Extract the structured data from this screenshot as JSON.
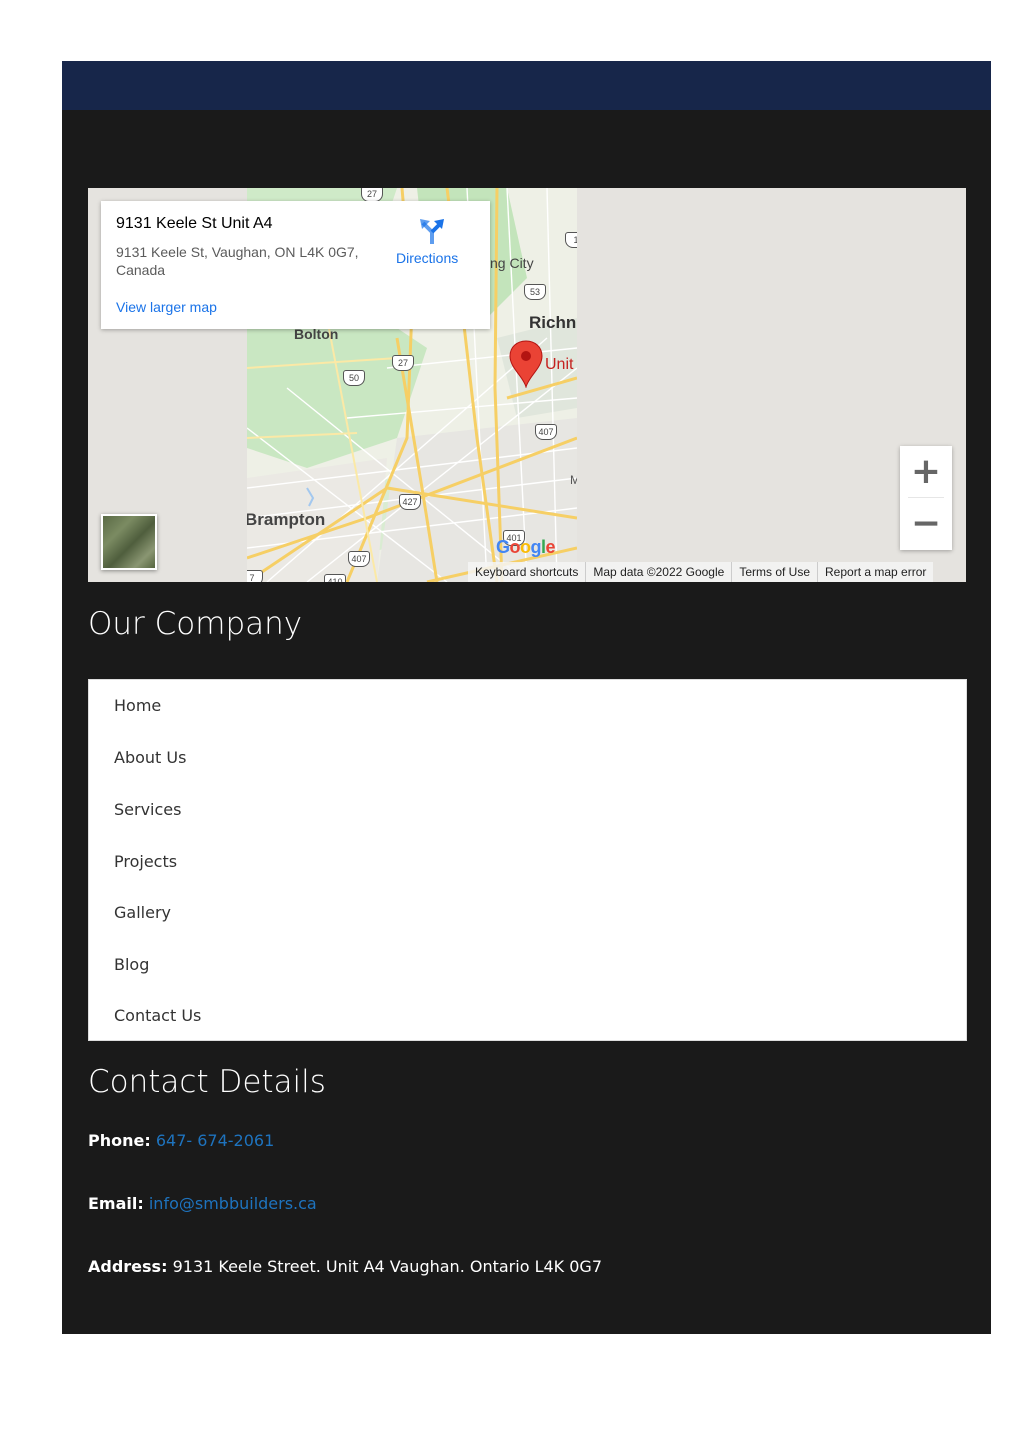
{
  "map": {
    "place_title": "9131 Keele St Unit A4",
    "place_address": "9131 Keele St, Vaughan, ON L4K 0G7, Canada",
    "view_larger": "View larger map",
    "directions": "Directions",
    "footer": [
      "Keyboard shortcuts",
      "Map data ©2022 Google",
      "Terms of Use",
      "Report a map error"
    ],
    "zoom_in": "+",
    "zoom_out": "−",
    "city_labels": {
      "bolton": "Bolton",
      "brampton": "Brampton",
      "richmond": "Richn",
      "king_city": "ng City",
      "unit": "Unit",
      "m": "M"
    },
    "routes": [
      "27",
      "1",
      "53",
      "27",
      "50",
      "407",
      "427",
      "401",
      "407",
      "410",
      "7"
    ],
    "google_logo": "Google",
    "colors": {
      "pin": "#ea4335",
      "link": "#1a73e8"
    }
  },
  "company": {
    "title": "Our Company",
    "menu": [
      "Home",
      "About Us",
      "Services",
      "Projects",
      "Gallery",
      "Blog",
      "Contact Us"
    ]
  },
  "contact": {
    "title": "Contact Details",
    "phone_label": "Phone:",
    "phone": "647- 674-2061",
    "email_label": "Email:",
    "email": "info@smbbuilders.ca",
    "address_label": "Address:",
    "address": "9131 Keele Street. Unit A4 Vaughan. Ontario L4K 0G7"
  },
  "colors": {
    "header": "#17264a",
    "background": "#1a1a1a",
    "link": "#1e73be"
  }
}
